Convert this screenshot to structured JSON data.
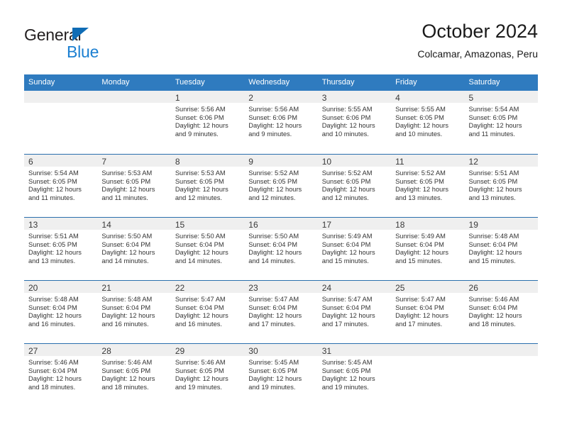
{
  "brand": {
    "name_top": "General",
    "name_bottom": "Blue",
    "accent_color": "#1b7fd1",
    "triangle_color": "#0f6cb5"
  },
  "header": {
    "month_title": "October 2024",
    "location": "Colcamar, Amazonas, Peru"
  },
  "calendar": {
    "header_color": "#2f7bbf",
    "day_band_color": "#efefef",
    "weekdays": [
      "Sunday",
      "Monday",
      "Tuesday",
      "Wednesday",
      "Thursday",
      "Friday",
      "Saturday"
    ],
    "weeks": [
      [
        {
          "day": "",
          "sunrise": "",
          "sunset": "",
          "daylight": ""
        },
        {
          "day": "",
          "sunrise": "",
          "sunset": "",
          "daylight": ""
        },
        {
          "day": "1",
          "sunrise": "Sunrise: 5:56 AM",
          "sunset": "Sunset: 6:06 PM",
          "daylight": "Daylight: 12 hours and 9 minutes."
        },
        {
          "day": "2",
          "sunrise": "Sunrise: 5:56 AM",
          "sunset": "Sunset: 6:06 PM",
          "daylight": "Daylight: 12 hours and 9 minutes."
        },
        {
          "day": "3",
          "sunrise": "Sunrise: 5:55 AM",
          "sunset": "Sunset: 6:06 PM",
          "daylight": "Daylight: 12 hours and 10 minutes."
        },
        {
          "day": "4",
          "sunrise": "Sunrise: 5:55 AM",
          "sunset": "Sunset: 6:05 PM",
          "daylight": "Daylight: 12 hours and 10 minutes."
        },
        {
          "day": "5",
          "sunrise": "Sunrise: 5:54 AM",
          "sunset": "Sunset: 6:05 PM",
          "daylight": "Daylight: 12 hours and 11 minutes."
        }
      ],
      [
        {
          "day": "6",
          "sunrise": "Sunrise: 5:54 AM",
          "sunset": "Sunset: 6:05 PM",
          "daylight": "Daylight: 12 hours and 11 minutes."
        },
        {
          "day": "7",
          "sunrise": "Sunrise: 5:53 AM",
          "sunset": "Sunset: 6:05 PM",
          "daylight": "Daylight: 12 hours and 11 minutes."
        },
        {
          "day": "8",
          "sunrise": "Sunrise: 5:53 AM",
          "sunset": "Sunset: 6:05 PM",
          "daylight": "Daylight: 12 hours and 12 minutes."
        },
        {
          "day": "9",
          "sunrise": "Sunrise: 5:52 AM",
          "sunset": "Sunset: 6:05 PM",
          "daylight": "Daylight: 12 hours and 12 minutes."
        },
        {
          "day": "10",
          "sunrise": "Sunrise: 5:52 AM",
          "sunset": "Sunset: 6:05 PM",
          "daylight": "Daylight: 12 hours and 12 minutes."
        },
        {
          "day": "11",
          "sunrise": "Sunrise: 5:52 AM",
          "sunset": "Sunset: 6:05 PM",
          "daylight": "Daylight: 12 hours and 13 minutes."
        },
        {
          "day": "12",
          "sunrise": "Sunrise: 5:51 AM",
          "sunset": "Sunset: 6:05 PM",
          "daylight": "Daylight: 12 hours and 13 minutes."
        }
      ],
      [
        {
          "day": "13",
          "sunrise": "Sunrise: 5:51 AM",
          "sunset": "Sunset: 6:05 PM",
          "daylight": "Daylight: 12 hours and 13 minutes."
        },
        {
          "day": "14",
          "sunrise": "Sunrise: 5:50 AM",
          "sunset": "Sunset: 6:04 PM",
          "daylight": "Daylight: 12 hours and 14 minutes."
        },
        {
          "day": "15",
          "sunrise": "Sunrise: 5:50 AM",
          "sunset": "Sunset: 6:04 PM",
          "daylight": "Daylight: 12 hours and 14 minutes."
        },
        {
          "day": "16",
          "sunrise": "Sunrise: 5:50 AM",
          "sunset": "Sunset: 6:04 PM",
          "daylight": "Daylight: 12 hours and 14 minutes."
        },
        {
          "day": "17",
          "sunrise": "Sunrise: 5:49 AM",
          "sunset": "Sunset: 6:04 PM",
          "daylight": "Daylight: 12 hours and 15 minutes."
        },
        {
          "day": "18",
          "sunrise": "Sunrise: 5:49 AM",
          "sunset": "Sunset: 6:04 PM",
          "daylight": "Daylight: 12 hours and 15 minutes."
        },
        {
          "day": "19",
          "sunrise": "Sunrise: 5:48 AM",
          "sunset": "Sunset: 6:04 PM",
          "daylight": "Daylight: 12 hours and 15 minutes."
        }
      ],
      [
        {
          "day": "20",
          "sunrise": "Sunrise: 5:48 AM",
          "sunset": "Sunset: 6:04 PM",
          "daylight": "Daylight: 12 hours and 16 minutes."
        },
        {
          "day": "21",
          "sunrise": "Sunrise: 5:48 AM",
          "sunset": "Sunset: 6:04 PM",
          "daylight": "Daylight: 12 hours and 16 minutes."
        },
        {
          "day": "22",
          "sunrise": "Sunrise: 5:47 AM",
          "sunset": "Sunset: 6:04 PM",
          "daylight": "Daylight: 12 hours and 16 minutes."
        },
        {
          "day": "23",
          "sunrise": "Sunrise: 5:47 AM",
          "sunset": "Sunset: 6:04 PM",
          "daylight": "Daylight: 12 hours and 17 minutes."
        },
        {
          "day": "24",
          "sunrise": "Sunrise: 5:47 AM",
          "sunset": "Sunset: 6:04 PM",
          "daylight": "Daylight: 12 hours and 17 minutes."
        },
        {
          "day": "25",
          "sunrise": "Sunrise: 5:47 AM",
          "sunset": "Sunset: 6:04 PM",
          "daylight": "Daylight: 12 hours and 17 minutes."
        },
        {
          "day": "26",
          "sunrise": "Sunrise: 5:46 AM",
          "sunset": "Sunset: 6:04 PM",
          "daylight": "Daylight: 12 hours and 18 minutes."
        }
      ],
      [
        {
          "day": "27",
          "sunrise": "Sunrise: 5:46 AM",
          "sunset": "Sunset: 6:04 PM",
          "daylight": "Daylight: 12 hours and 18 minutes."
        },
        {
          "day": "28",
          "sunrise": "Sunrise: 5:46 AM",
          "sunset": "Sunset: 6:05 PM",
          "daylight": "Daylight: 12 hours and 18 minutes."
        },
        {
          "day": "29",
          "sunrise": "Sunrise: 5:46 AM",
          "sunset": "Sunset: 6:05 PM",
          "daylight": "Daylight: 12 hours and 19 minutes."
        },
        {
          "day": "30",
          "sunrise": "Sunrise: 5:45 AM",
          "sunset": "Sunset: 6:05 PM",
          "daylight": "Daylight: 12 hours and 19 minutes."
        },
        {
          "day": "31",
          "sunrise": "Sunrise: 5:45 AM",
          "sunset": "Sunset: 6:05 PM",
          "daylight": "Daylight: 12 hours and 19 minutes."
        },
        {
          "day": "",
          "sunrise": "",
          "sunset": "",
          "daylight": ""
        },
        {
          "day": "",
          "sunrise": "",
          "sunset": "",
          "daylight": ""
        }
      ]
    ]
  }
}
